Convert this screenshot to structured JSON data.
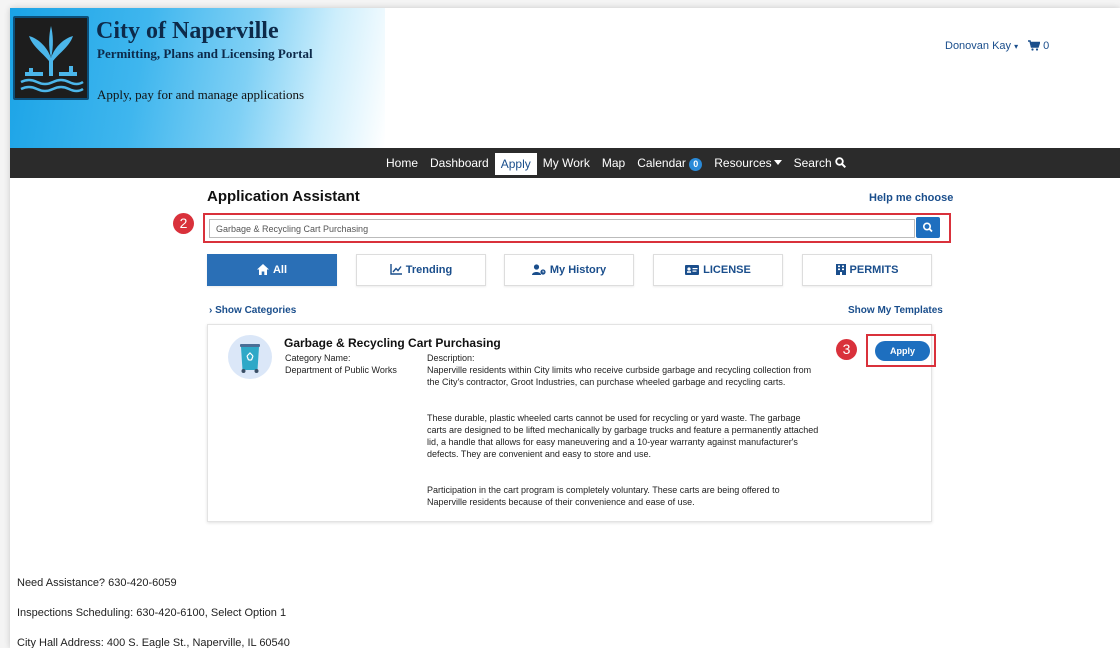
{
  "header": {
    "title": "City of Naperville",
    "subtitle": "Permitting, Plans and Licensing Portal",
    "tagline": "Apply, pay for and manage applications",
    "user_name": "Donovan Kay",
    "cart_count": "0"
  },
  "nav": {
    "items": [
      {
        "label": "Home"
      },
      {
        "label": "Dashboard"
      },
      {
        "label": "Apply"
      },
      {
        "label": "My Work"
      },
      {
        "label": "Map"
      },
      {
        "label": "Calendar"
      },
      {
        "label": "Resources"
      },
      {
        "label": "Search"
      }
    ],
    "calendar_badge": "0",
    "active": "Apply"
  },
  "main": {
    "title": "Application Assistant",
    "help_link": "Help me choose",
    "search_value": "Garbage & Recycling Cart Purchasing",
    "step_search": "2",
    "step_apply": "3",
    "tabs": [
      {
        "label": "All"
      },
      {
        "label": "Trending"
      },
      {
        "label": "My History"
      },
      {
        "label": "LICENSE"
      },
      {
        "label": "PERMITS"
      }
    ],
    "show_categories": "Show Categories",
    "show_templates": "Show My Templates"
  },
  "result": {
    "title": "Garbage & Recycling Cart Purchasing",
    "category_label": "Category Name:",
    "category_value": "Department of Public Works",
    "description_label": "Description:",
    "description": [
      "Naperville residents within City limits who receive curbside garbage and recycling collection from the City's contractor, Groot Industries, can purchase wheeled garbage and recycling carts.",
      "These durable, plastic wheeled carts cannot be used for recycling or yard waste. The garbage carts are designed to be lifted mechanically by garbage trucks and feature a permanently attached lid, a handle that allows for easy maneuvering and a 10-year warranty against manufacturer's defects. They are convenient and easy to store and use.",
      "Participation in the cart program is completely voluntary. These carts are being offered to Naperville residents because of their convenience and ease of use."
    ],
    "apply_label": "Apply"
  },
  "footer": {
    "assistance": "Need Assistance? 630-420-6059",
    "inspections": "Inspections Scheduling: 630-420-6100, Select Option 1",
    "address": "City Hall Address: 400 S. Eagle St., Naperville, IL 60540"
  },
  "colors": {
    "brand_blue": "#1e6fbf",
    "nav_bg": "#2b2b2b",
    "highlight_red": "#d9313b"
  }
}
